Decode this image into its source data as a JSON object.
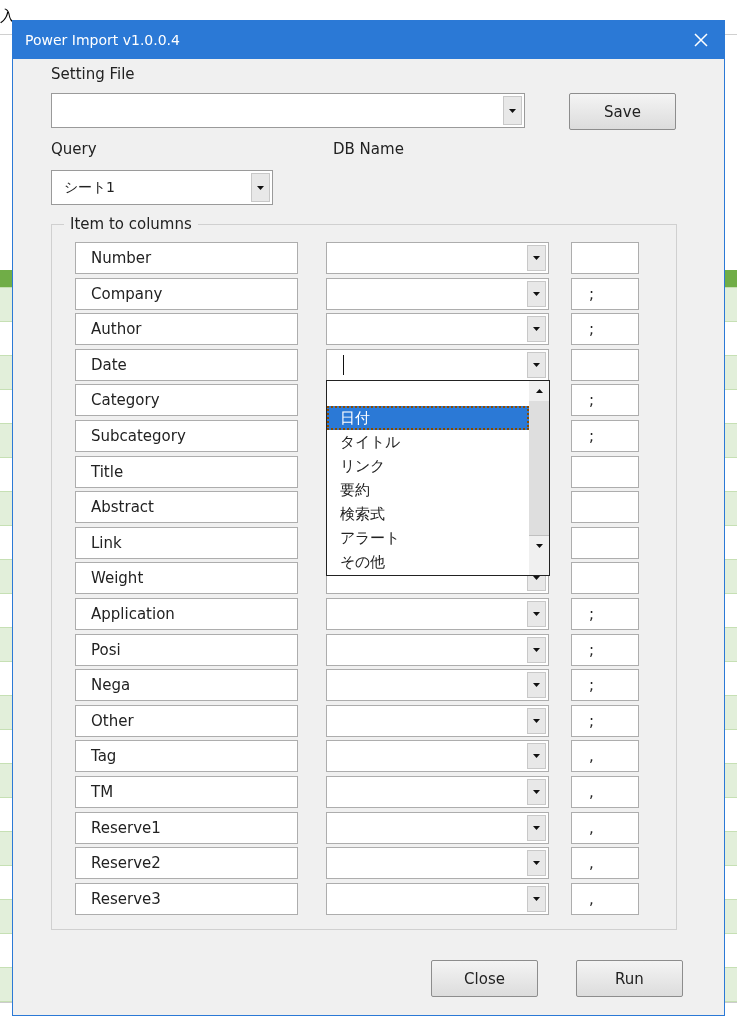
{
  "ribbon": {
    "tabs": [
      {
        "label": "入"
      }
    ]
  },
  "dialog": {
    "title": "Power Import v1.0.0.4",
    "setting_file": {
      "label": "Setting File"
    },
    "save_button": "Save",
    "query": {
      "label": "Query",
      "value": "シート1"
    },
    "db_name_label": "DB Name",
    "group": {
      "title": "Item to columns",
      "rows": [
        {
          "item": "Number"
        },
        {
          "item": "Company",
          "separator": ";"
        },
        {
          "item": "Author",
          "separator": ";"
        },
        {
          "item": "Date",
          "dropdown": {
            "items": [
              {
                "label": "日付",
                "selected": true
              },
              {
                "label": "タイトル",
                "selected": false
              },
              {
                "label": "リンク",
                "selected": false
              },
              {
                "label": "要約",
                "selected": false
              },
              {
                "label": "検索式",
                "selected": false
              },
              {
                "label": "アラート",
                "selected": false
              },
              {
                "label": "その他",
                "selected": false
              }
            ]
          }
        },
        {
          "item": "Category",
          "separator": ";"
        },
        {
          "item": "Subcategory",
          "separator": ";"
        },
        {
          "item": "Title"
        },
        {
          "item": "Abstract"
        },
        {
          "item": "Link"
        },
        {
          "item": "Weight"
        },
        {
          "item": "Application",
          "separator": ";"
        },
        {
          "item": "Posi",
          "separator": ";"
        },
        {
          "item": "Nega",
          "separator": ";"
        },
        {
          "item": "Other",
          "separator": ";"
        },
        {
          "item": "Tag",
          "separator": ","
        },
        {
          "item": "TM",
          "separator": ","
        },
        {
          "item": "Reserve1",
          "separator": ","
        },
        {
          "item": "Reserve2",
          "separator": ","
        },
        {
          "item": "Reserve3",
          "separator": ","
        }
      ]
    },
    "buttons": [
      "Close",
      "Run"
    ]
  }
}
